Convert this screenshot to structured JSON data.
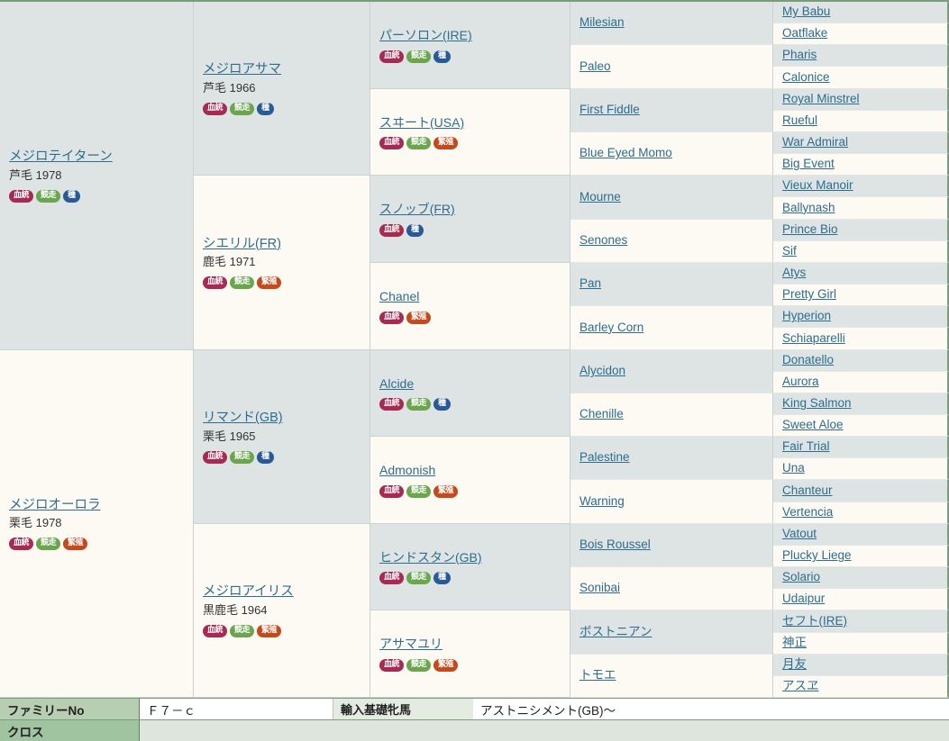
{
  "badge_labels": {
    "ketto": "血統",
    "kyoso": "競走",
    "tane": "種",
    "hansyoku": "繁殖"
  },
  "badge_colors": {
    "ketto": "#a72a52",
    "kyoso": "#6ba64f",
    "tane": "#2a5a95",
    "hansyoku": "#c4491c"
  },
  "cell_colors": {
    "sire": "#dde4e3",
    "dam": "#fdfaf4",
    "link": "#2e6d8e",
    "footer_label": "#b7ceb2",
    "cross_label": "#9fc49f"
  },
  "generations": {
    "g1": [
      {
        "name": "メジロテイターン",
        "coat": "芦毛",
        "year": "1978",
        "badges": [
          "ketto",
          "kyoso",
          "tane"
        ],
        "type": "sire"
      },
      {
        "name": "メジロオーロラ",
        "coat": "栗毛",
        "year": "1978",
        "badges": [
          "ketto",
          "kyoso",
          "hansyoku"
        ],
        "type": "dam"
      }
    ],
    "g2": [
      {
        "name": "メジロアサマ",
        "coat": "芦毛",
        "year": "1966",
        "badges": [
          "ketto",
          "kyoso",
          "tane"
        ],
        "type": "sire"
      },
      {
        "name": "シエリル(FR)",
        "coat": "鹿毛",
        "year": "1971",
        "badges": [
          "ketto",
          "kyoso",
          "hansyoku"
        ],
        "type": "dam"
      },
      {
        "name": "リマンド(GB)",
        "coat": "栗毛",
        "year": "1965",
        "badges": [
          "ketto",
          "kyoso",
          "tane"
        ],
        "type": "sire"
      },
      {
        "name": "メジロアイリス",
        "coat": "黒鹿毛",
        "year": "1964",
        "badges": [
          "ketto",
          "kyoso",
          "hansyoku"
        ],
        "type": "dam"
      }
    ],
    "g3": [
      {
        "name": "パーソロン(IRE)",
        "badges": [
          "ketto",
          "kyoso",
          "tane"
        ],
        "type": "sire"
      },
      {
        "name": "スヰート(USA)",
        "badges": [
          "ketto",
          "kyoso",
          "hansyoku"
        ],
        "type": "dam"
      },
      {
        "name": "スノッブ(FR)",
        "badges": [
          "ketto",
          "tane"
        ],
        "type": "sire"
      },
      {
        "name": "Chanel",
        "badges": [
          "ketto",
          "hansyoku"
        ],
        "type": "dam"
      },
      {
        "name": "Alcide",
        "badges": [
          "ketto",
          "kyoso",
          "tane"
        ],
        "type": "sire"
      },
      {
        "name": "Admonish",
        "badges": [
          "ketto",
          "kyoso",
          "hansyoku"
        ],
        "type": "dam"
      },
      {
        "name": "ヒンドスタン(GB)",
        "badges": [
          "ketto",
          "kyoso",
          "tane"
        ],
        "type": "sire"
      },
      {
        "name": "アサマユリ",
        "badges": [
          "ketto",
          "kyoso",
          "hansyoku"
        ],
        "type": "dam"
      }
    ],
    "g4": [
      {
        "name": "Milesian",
        "type": "sire"
      },
      {
        "name": "Paleo",
        "type": "dam"
      },
      {
        "name": "First Fiddle",
        "type": "sire"
      },
      {
        "name": "Blue Eyed Momo",
        "type": "dam"
      },
      {
        "name": "Mourne",
        "type": "sire"
      },
      {
        "name": "Senones",
        "type": "dam"
      },
      {
        "name": "Pan",
        "type": "sire"
      },
      {
        "name": "Barley Corn",
        "type": "dam"
      },
      {
        "name": "Alycidon",
        "type": "sire"
      },
      {
        "name": "Chenille",
        "type": "dam"
      },
      {
        "name": "Palestine",
        "type": "sire"
      },
      {
        "name": "Warning",
        "type": "dam"
      },
      {
        "name": "Bois Roussel",
        "type": "sire"
      },
      {
        "name": "Sonibai",
        "type": "dam"
      },
      {
        "name": "ボストニアン",
        "type": "sire"
      },
      {
        "name": "トモエ",
        "type": "dam"
      }
    ],
    "g5": [
      {
        "name": "My Babu",
        "type": "sire"
      },
      {
        "name": "Oatflake",
        "type": "dam"
      },
      {
        "name": "Pharis",
        "type": "sire"
      },
      {
        "name": "Calonice",
        "type": "dam"
      },
      {
        "name": "Royal Minstrel",
        "type": "sire"
      },
      {
        "name": "Rueful",
        "type": "dam"
      },
      {
        "name": "War Admiral",
        "type": "sire"
      },
      {
        "name": "Big Event",
        "type": "dam"
      },
      {
        "name": "Vieux Manoir",
        "type": "sire"
      },
      {
        "name": "Ballynash",
        "type": "dam"
      },
      {
        "name": "Prince Bio",
        "type": "sire"
      },
      {
        "name": "Sif",
        "type": "dam"
      },
      {
        "name": "Atys",
        "type": "sire"
      },
      {
        "name": "Pretty Girl",
        "type": "dam"
      },
      {
        "name": "Hyperion",
        "type": "sire"
      },
      {
        "name": "Schiaparelli",
        "type": "dam"
      },
      {
        "name": "Donatello",
        "type": "sire"
      },
      {
        "name": "Aurora",
        "type": "dam"
      },
      {
        "name": "King Salmon",
        "type": "sire"
      },
      {
        "name": "Sweet Aloe",
        "type": "dam"
      },
      {
        "name": "Fair Trial",
        "type": "sire"
      },
      {
        "name": "Una",
        "type": "dam"
      },
      {
        "name": "Chanteur",
        "type": "sire"
      },
      {
        "name": "Vertencia",
        "type": "dam"
      },
      {
        "name": "Vatout",
        "type": "sire"
      },
      {
        "name": "Plucky Liege",
        "type": "dam"
      },
      {
        "name": "Solario",
        "type": "sire"
      },
      {
        "name": "Udaipur",
        "type": "dam"
      },
      {
        "name": "セフト(IRE)",
        "type": "sire"
      },
      {
        "name": "神正",
        "type": "dam"
      },
      {
        "name": "月友",
        "type": "sire"
      },
      {
        "name": "アスヱ",
        "type": "dam"
      }
    ]
  },
  "footer": {
    "family_no_label": "ファミリーNo",
    "family_no_value": "Ｆ７－ｃ",
    "base_mare_label": "輸入基礎牝馬",
    "base_mare_value": "アストニシメント(GB)～",
    "cross_label": "クロス",
    "cross_value": ""
  }
}
